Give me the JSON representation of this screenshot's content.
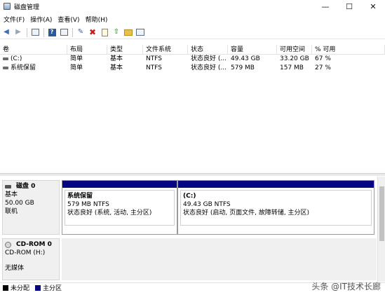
{
  "window": {
    "title": "磁盘管理",
    "minimize": "—",
    "maximize": "☐",
    "close": "✕"
  },
  "menu": [
    "文件(F)",
    "操作(A)",
    "查看(V)",
    "帮助(H)"
  ],
  "toolbar_icons": [
    "back-arrow-icon",
    "forward-arrow-icon",
    "console-tree-icon",
    "help-icon",
    "properties-icon",
    "connect-icon",
    "delete-icon",
    "check-icon",
    "open-folder-icon",
    "export-icon",
    "list-icon"
  ],
  "volume_table": {
    "columns": [
      "卷",
      "布局",
      "类型",
      "文件系统",
      "状态",
      "容量",
      "可用空间",
      "% 可用"
    ],
    "rows": [
      [
        "(C:)",
        "简单",
        "基本",
        "NTFS",
        "状态良好 (...",
        "49.43 GB",
        "33.20 GB",
        "67 %"
      ],
      [
        "系统保留",
        "简单",
        "基本",
        "NTFS",
        "状态良好 (...",
        "579 MB",
        "157 MB",
        "27 %"
      ]
    ]
  },
  "disks": [
    {
      "name": "磁盘 0",
      "type": "基本",
      "size": "50.00 GB",
      "status": "联机",
      "partitions": [
        {
          "name": "系统保留",
          "size": "579 MB NTFS",
          "status": "状态良好 (系统, 活动, 主分区)"
        },
        {
          "name": "(C:)",
          "size": "49.43 GB NTFS",
          "status": "状态良好 (启动, 页面文件, 故障转储, 主分区)"
        }
      ]
    },
    {
      "name": "CD-ROM 0",
      "type": "CD-ROM (H:)",
      "status": "无媒体"
    }
  ],
  "legend": [
    {
      "label": "未分配",
      "color": "#000000"
    },
    {
      "label": "主分区",
      "color": "#05067f"
    }
  ],
  "watermark": "头条 @IT技术长廊"
}
